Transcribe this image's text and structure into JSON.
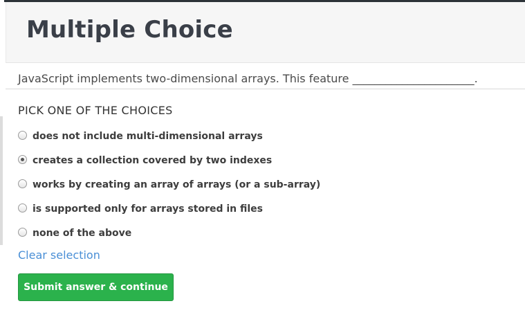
{
  "header": {
    "title": "Multiple Choice"
  },
  "question": {
    "text": "JavaScript implements two-dimensional arrays. This feature ______________________."
  },
  "choices_section": {
    "label": "PICK ONE OF THE CHOICES",
    "options": [
      {
        "label": "does not include multi-dimensional arrays",
        "selected": false
      },
      {
        "label": "creates a collection covered by two indexes",
        "selected": true
      },
      {
        "label": "works by creating an array of arrays (or a sub-array)",
        "selected": false
      },
      {
        "label": "is supported only for arrays stored in files",
        "selected": false
      },
      {
        "label": "none of the above",
        "selected": false
      }
    ],
    "clear_label": "Clear selection"
  },
  "actions": {
    "submit_label": "Submit answer & continue"
  },
  "colors": {
    "submit_green": "#2bb24c",
    "link_blue": "#4a8fd6",
    "header_bg": "#f6f6f6"
  }
}
